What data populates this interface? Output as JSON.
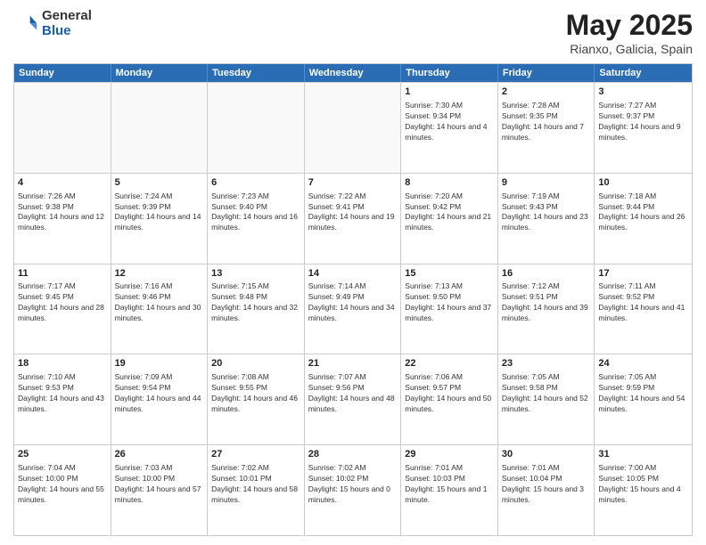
{
  "header": {
    "logo_general": "General",
    "logo_blue": "Blue",
    "title": "May 2025",
    "subtitle": "Rianxo, Galicia, Spain"
  },
  "weekdays": [
    "Sunday",
    "Monday",
    "Tuesday",
    "Wednesday",
    "Thursday",
    "Friday",
    "Saturday"
  ],
  "rows": [
    [
      {
        "day": "",
        "empty": true
      },
      {
        "day": "",
        "empty": true
      },
      {
        "day": "",
        "empty": true
      },
      {
        "day": "",
        "empty": true
      },
      {
        "day": "1",
        "sunrise": "7:30 AM",
        "sunset": "9:34 PM",
        "daylight": "14 hours and 4 minutes."
      },
      {
        "day": "2",
        "sunrise": "7:28 AM",
        "sunset": "9:35 PM",
        "daylight": "14 hours and 7 minutes."
      },
      {
        "day": "3",
        "sunrise": "7:27 AM",
        "sunset": "9:37 PM",
        "daylight": "14 hours and 9 minutes."
      }
    ],
    [
      {
        "day": "4",
        "sunrise": "7:26 AM",
        "sunset": "9:38 PM",
        "daylight": "14 hours and 12 minutes."
      },
      {
        "day": "5",
        "sunrise": "7:24 AM",
        "sunset": "9:39 PM",
        "daylight": "14 hours and 14 minutes."
      },
      {
        "day": "6",
        "sunrise": "7:23 AM",
        "sunset": "9:40 PM",
        "daylight": "14 hours and 16 minutes."
      },
      {
        "day": "7",
        "sunrise": "7:22 AM",
        "sunset": "9:41 PM",
        "daylight": "14 hours and 19 minutes."
      },
      {
        "day": "8",
        "sunrise": "7:20 AM",
        "sunset": "9:42 PM",
        "daylight": "14 hours and 21 minutes."
      },
      {
        "day": "9",
        "sunrise": "7:19 AM",
        "sunset": "9:43 PM",
        "daylight": "14 hours and 23 minutes."
      },
      {
        "day": "10",
        "sunrise": "7:18 AM",
        "sunset": "9:44 PM",
        "daylight": "14 hours and 26 minutes."
      }
    ],
    [
      {
        "day": "11",
        "sunrise": "7:17 AM",
        "sunset": "9:45 PM",
        "daylight": "14 hours and 28 minutes."
      },
      {
        "day": "12",
        "sunrise": "7:16 AM",
        "sunset": "9:46 PM",
        "daylight": "14 hours and 30 minutes."
      },
      {
        "day": "13",
        "sunrise": "7:15 AM",
        "sunset": "9:48 PM",
        "daylight": "14 hours and 32 minutes."
      },
      {
        "day": "14",
        "sunrise": "7:14 AM",
        "sunset": "9:49 PM",
        "daylight": "14 hours and 34 minutes."
      },
      {
        "day": "15",
        "sunrise": "7:13 AM",
        "sunset": "9:50 PM",
        "daylight": "14 hours and 37 minutes."
      },
      {
        "day": "16",
        "sunrise": "7:12 AM",
        "sunset": "9:51 PM",
        "daylight": "14 hours and 39 minutes."
      },
      {
        "day": "17",
        "sunrise": "7:11 AM",
        "sunset": "9:52 PM",
        "daylight": "14 hours and 41 minutes."
      }
    ],
    [
      {
        "day": "18",
        "sunrise": "7:10 AM",
        "sunset": "9:53 PM",
        "daylight": "14 hours and 43 minutes."
      },
      {
        "day": "19",
        "sunrise": "7:09 AM",
        "sunset": "9:54 PM",
        "daylight": "14 hours and 44 minutes."
      },
      {
        "day": "20",
        "sunrise": "7:08 AM",
        "sunset": "9:55 PM",
        "daylight": "14 hours and 46 minutes."
      },
      {
        "day": "21",
        "sunrise": "7:07 AM",
        "sunset": "9:56 PM",
        "daylight": "14 hours and 48 minutes."
      },
      {
        "day": "22",
        "sunrise": "7:06 AM",
        "sunset": "9:57 PM",
        "daylight": "14 hours and 50 minutes."
      },
      {
        "day": "23",
        "sunrise": "7:05 AM",
        "sunset": "9:58 PM",
        "daylight": "14 hours and 52 minutes."
      },
      {
        "day": "24",
        "sunrise": "7:05 AM",
        "sunset": "9:59 PM",
        "daylight": "14 hours and 54 minutes."
      }
    ],
    [
      {
        "day": "25",
        "sunrise": "7:04 AM",
        "sunset": "10:00 PM",
        "daylight": "14 hours and 55 minutes."
      },
      {
        "day": "26",
        "sunrise": "7:03 AM",
        "sunset": "10:00 PM",
        "daylight": "14 hours and 57 minutes."
      },
      {
        "day": "27",
        "sunrise": "7:02 AM",
        "sunset": "10:01 PM",
        "daylight": "14 hours and 58 minutes."
      },
      {
        "day": "28",
        "sunrise": "7:02 AM",
        "sunset": "10:02 PM",
        "daylight": "15 hours and 0 minutes."
      },
      {
        "day": "29",
        "sunrise": "7:01 AM",
        "sunset": "10:03 PM",
        "daylight": "15 hours and 1 minute."
      },
      {
        "day": "30",
        "sunrise": "7:01 AM",
        "sunset": "10:04 PM",
        "daylight": "15 hours and 3 minutes."
      },
      {
        "day": "31",
        "sunrise": "7:00 AM",
        "sunset": "10:05 PM",
        "daylight": "15 hours and 4 minutes."
      }
    ]
  ]
}
